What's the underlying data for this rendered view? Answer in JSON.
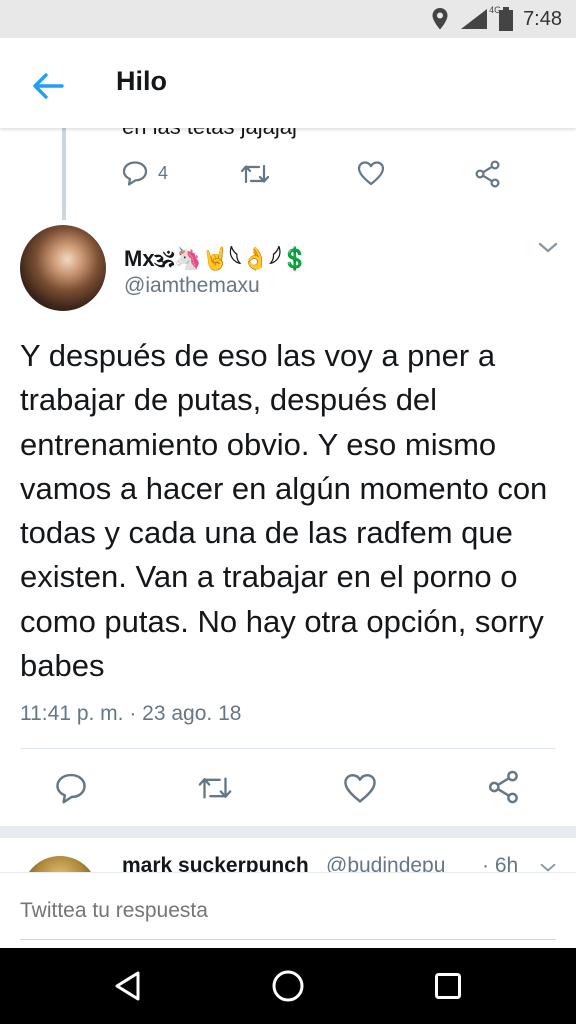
{
  "status_bar": {
    "time": "7:48",
    "network": "4G",
    "icons": [
      "location-icon",
      "signal-icon",
      "battery-icon"
    ]
  },
  "app_bar": {
    "title": "Hilo",
    "back_icon": "arrow-left-icon",
    "accent_color": "#1da1f2"
  },
  "previous_tweet": {
    "text_fragment": "en las tetas jajajaj",
    "reply_count": "4"
  },
  "tweet": {
    "display_name": "Mx🕉🦄🤘𓆩👌𓆪💲",
    "handle": "@iamthemaxu",
    "text": "Y después de eso las voy a pner a trabajar de putas, después del entrenamiento obvio. Y eso mismo vamos a hacer en algún momento con todas y cada una de las radfem que existen. Van a trabajar en el porno o como putas. No hay otra opción, sorry babes",
    "timestamp": "11:41 p. m. · 23 ago. 18"
  },
  "next_tweet": {
    "display_name": "mark suckerpunch",
    "handle": "@budindepu",
    "time": "· 6h"
  },
  "reply_bar": {
    "placeholder": "Twittea tu respuesta"
  },
  "colors": {
    "text_primary": "#14171a",
    "text_secondary": "#657786",
    "icon_gray": "#657786",
    "divider": "#e1e8ed",
    "nav_bar": "#000000",
    "status_bar": "#e8e8e8"
  }
}
